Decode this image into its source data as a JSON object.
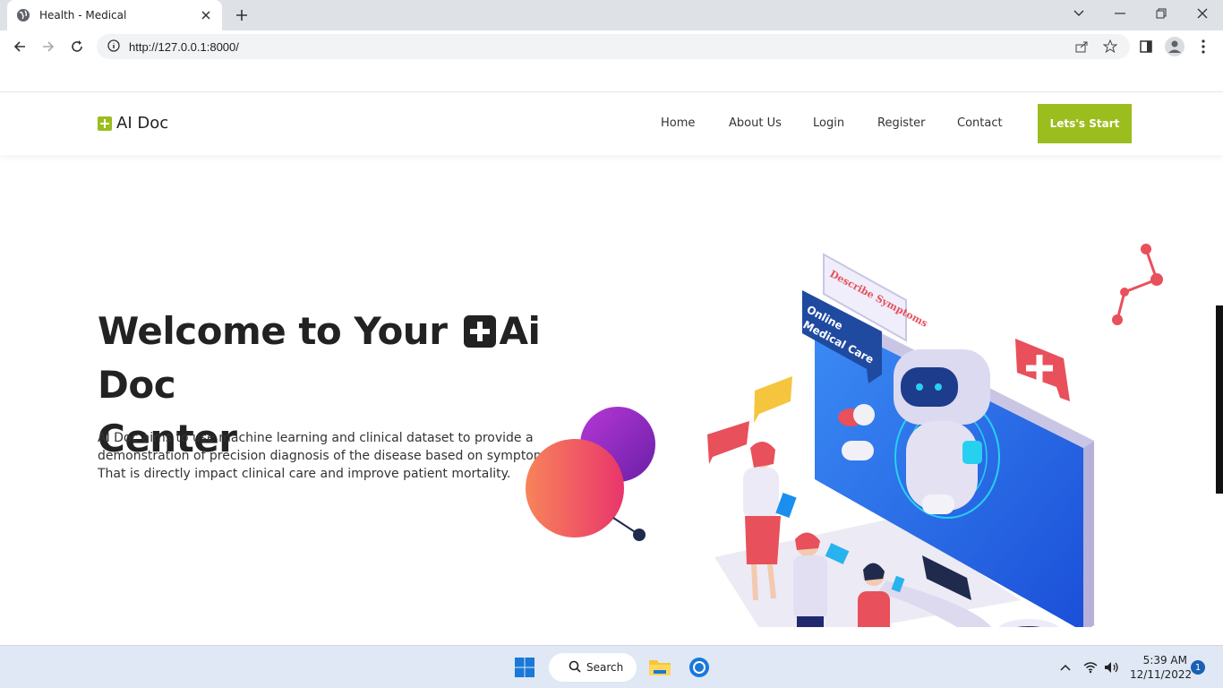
{
  "browser": {
    "tab_title": "Health - Medical",
    "url": "http://127.0.0.1:8000/"
  },
  "site": {
    "logo_text": "AI Doc",
    "nav": {
      "home": "Home",
      "about": "About Us",
      "login": "Login",
      "register": "Register",
      "contact": "Contact"
    },
    "cta_label": "Lets's Start",
    "brand_color": "#9cbd1e"
  },
  "hero": {
    "title_part1": "Welcome to Your",
    "title_part2": "Ai Doc",
    "title_part3": "Center",
    "description": "AI Doc aims to use machine learning and clinical dataset to provide a demonstration of precision diagnosis of the disease based on symptoms. That is directly impact clinical care and improve patient mortality.",
    "illustration_labels": {
      "sign1": "Describe Symptoms",
      "sign2_line1": "Online",
      "sign2_line2": "Medical Care"
    }
  },
  "taskbar": {
    "search_label": "Search",
    "time": "5:39 AM",
    "date": "12/11/2022",
    "notification_count": "1"
  }
}
